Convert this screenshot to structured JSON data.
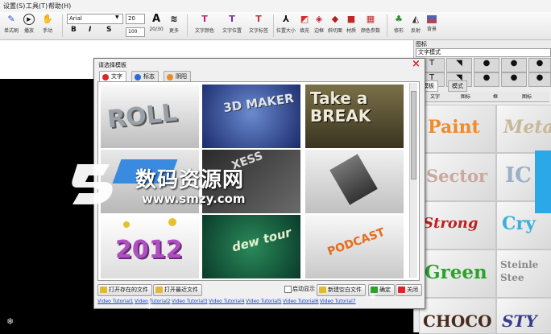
{
  "menubar": {
    "items": [
      "设置(S)",
      "工具(T)",
      "帮助(H)"
    ]
  },
  "toolbar": {
    "font_name": "Arial",
    "font_size": "20",
    "font_size2": "100",
    "buttons": [
      "单式刷",
      "播放",
      "手动",
      "20/30",
      "更多",
      "文字颜色",
      "文字位置",
      "文字标签",
      "位置大小",
      "填充",
      "边框",
      "斜切面",
      "材质",
      "颜色参数",
      "修形",
      "反射",
      "背景"
    ],
    "format_bold": "B",
    "format_italic": "I",
    "format_strike": "S",
    "size_a": "A"
  },
  "right_panel": {
    "title1": "图标",
    "title2": "文字模式",
    "tabs": [
      "模板",
      "模式"
    ],
    "subtabs": [
      "文字",
      "图标",
      "框",
      "图标"
    ],
    "gallery": [
      "Paint",
      "Meta",
      "Sector",
      "IC",
      "Strong",
      "Cry",
      "Green",
      "Steinle Stee",
      "CHOCO",
      "STY"
    ]
  },
  "dialog": {
    "title": "请选择模板",
    "close": "×",
    "tabs": [
      "文字",
      "标志",
      "阴阳"
    ],
    "thumbnails": [
      {
        "text": "ROLL"
      },
      {
        "text": "3D MAKER"
      },
      {
        "text": "Take a BREAK"
      },
      {
        "text": ""
      },
      {
        "text": "XESS"
      },
      {
        "text": ""
      },
      {
        "text": "2012"
      },
      {
        "text": "dew tour"
      },
      {
        "text": "PODCAST"
      }
    ],
    "buttons": {
      "open_existing": "打开存在的文件",
      "open_recent": "打开最近文件",
      "startup_check": "启动显示",
      "new_blank": "新建空白文件",
      "confirm": "确定",
      "close": "关闭"
    },
    "links": [
      "Video Tutorial1",
      "Video Tutorial2",
      "Video Tutorial3",
      "Video Tutorial4",
      "Video Tutorial5",
      "Video Tutorial6",
      "Video Tutorial7"
    ]
  },
  "watermark": {
    "main": "数码资源网",
    "sub": "www.smzy.com"
  },
  "colors": {
    "accent_red": "#d8262a",
    "link_blue": "#1a3cd0",
    "panel_bg": "#f0f0f0"
  }
}
